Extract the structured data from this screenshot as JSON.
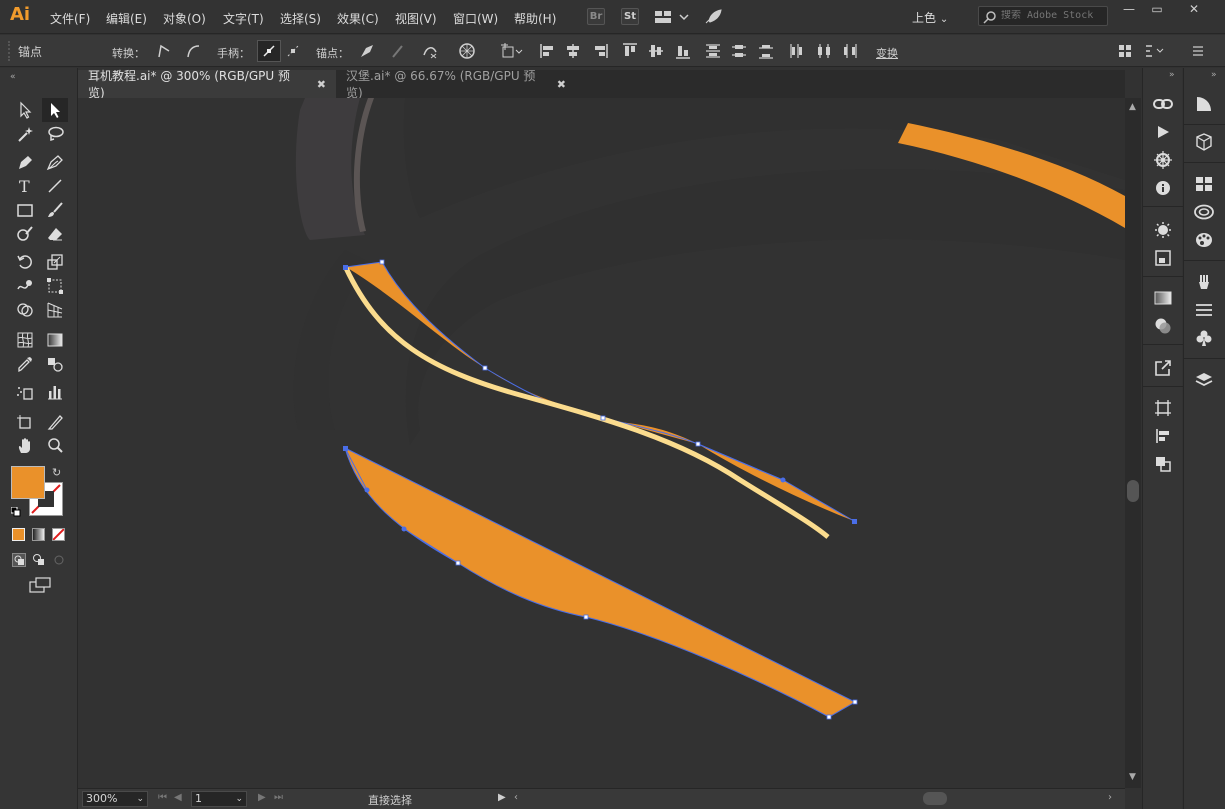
{
  "app": {
    "logo": "Ai",
    "menus": [
      "文件(F)",
      "编辑(E)",
      "对象(O)",
      "文字(T)",
      "选择(S)",
      "效果(C)",
      "视图(V)",
      "窗口(W)",
      "帮助(H)"
    ],
    "bridge_badge": "Br",
    "stock_badge": "St",
    "workspace": "上色",
    "search_placeholder": "搜索 Adobe Stock"
  },
  "control_bar": {
    "anchor_label": "锚点",
    "convert_label": "转换：",
    "handles_label": "手柄：",
    "anchors_label": "锚点：",
    "transform_label": "变换"
  },
  "tabs": [
    {
      "label": "耳机教程.ai* @ 300% (RGB/GPU 预览)",
      "active": true
    },
    {
      "label": "汉堡.ai* @ 66.67% (RGB/GPU 预览)",
      "active": false
    }
  ],
  "status_bar": {
    "zoom": "300%",
    "artboard": "1",
    "tool_name": "直接选择"
  },
  "colors": {
    "fill": "#ea912a",
    "accent_orange": "#f19b2c",
    "stroke_cream": "#fbdc8e",
    "selection_blue": "#4a6ee8"
  }
}
